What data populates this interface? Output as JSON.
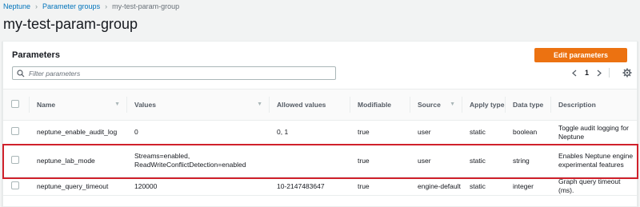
{
  "breadcrumb": {
    "items": [
      "Neptune",
      "Parameter groups",
      "my-test-param-group"
    ]
  },
  "page": {
    "title": "my-test-param-group"
  },
  "panel": {
    "title": "Parameters",
    "edit_label": "Edit parameters",
    "filter_placeholder": "Filter parameters",
    "page_number": "1"
  },
  "table": {
    "headers": {
      "name": "Name",
      "values": "Values",
      "allowed": "Allowed values",
      "modifiable": "Modifiable",
      "source": "Source",
      "apply_type": "Apply type",
      "data_type": "Data type",
      "description": "Description"
    },
    "rows": [
      {
        "name": "neptune_enable_audit_log",
        "values": "0",
        "allowed": "0, 1",
        "modifiable": "true",
        "source": "user",
        "apply_type": "static",
        "data_type": "boolean",
        "description": "Toggle audit logging for Neptune"
      },
      {
        "name": "neptune_lab_mode",
        "values": "Streams=enabled, ReadWriteConflictDetection=enabled",
        "allowed": "",
        "modifiable": "true",
        "source": "user",
        "apply_type": "static",
        "data_type": "string",
        "description": "Enables Neptune engine experimental features"
      },
      {
        "name": "neptune_query_timeout",
        "values": "120000",
        "allowed": "10-2147483647",
        "modifiable": "true",
        "source": "engine-default",
        "apply_type": "static",
        "data_type": "integer",
        "description": "Graph query timeout (ms)."
      }
    ]
  },
  "colors": {
    "accent": "#ec7211",
    "link": "#0073bb",
    "highlight": "#d0212b"
  },
  "icons": [
    "chevron-right-icon",
    "search-icon",
    "chevron-left-icon",
    "chevron-right-icon",
    "settings-gear-icon",
    "sort-caret-icon"
  ]
}
